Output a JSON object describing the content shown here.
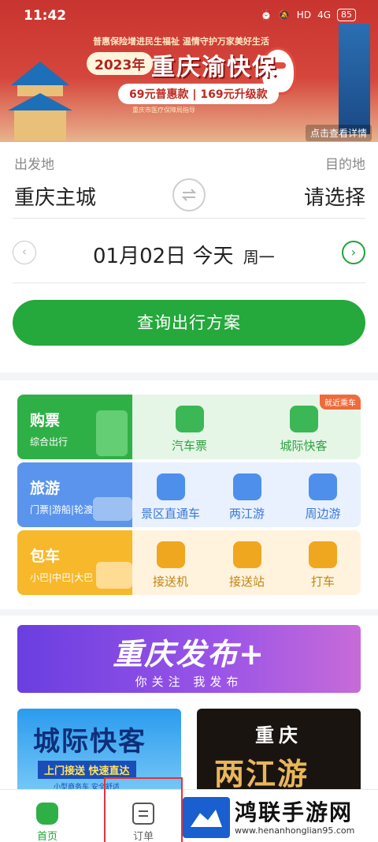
{
  "status_bar": {
    "time": "11:42",
    "network": "4G",
    "hd": "HD",
    "battery": "85"
  },
  "banner": {
    "slogan": "普惠保险增进民生福祉  温情守护万家美好生活",
    "year": "2023年",
    "title": "重庆渝快保",
    "price": "69元普惠款 | 169元升级款",
    "fine_print": "重庆市医疗保障局指导",
    "detail_link": "点击查看详情"
  },
  "search": {
    "from_label": "出发地",
    "to_label": "目的地",
    "from_city": "重庆主城",
    "to_city": "请选择",
    "date": "01月02日",
    "day": "今天",
    "weekday": "周一",
    "query_button": "查询出行方案"
  },
  "services": {
    "rows": [
      {
        "title": "购票",
        "subtitle": "综合出行",
        "items": [
          {
            "label": "汽车票",
            "icon": "car-icon"
          },
          {
            "label": "城际快客",
            "icon": "bus-icon",
            "tag": "就近乘车"
          }
        ]
      },
      {
        "title": "旅游",
        "subtitle": "门票|游船|轮渡",
        "items": [
          {
            "label": "景区直通车",
            "icon": "scenic-bus-icon"
          },
          {
            "label": "两江游",
            "icon": "boat-icon"
          },
          {
            "label": "周边游",
            "icon": "mountain-icon"
          }
        ]
      },
      {
        "title": "包车",
        "subtitle": "小巴|中巴|大巴",
        "items": [
          {
            "label": "接送机",
            "icon": "plane-car-icon"
          },
          {
            "label": "接送站",
            "icon": "station-car-icon"
          },
          {
            "label": "打车",
            "icon": "taxi-icon"
          }
        ]
      }
    ]
  },
  "promo": {
    "banner_title": "重庆发布+",
    "banner_subtitle": "你关注  我发布",
    "card_a_title": "城际快客",
    "card_a_tagline": "上门接送 快速直达",
    "card_a_fine": "小型商务车 安全舒适",
    "card_b_title_1": "重庆",
    "card_b_title_2": "两江游"
  },
  "nav": {
    "home": "首页",
    "orders": "订单"
  },
  "watermark": {
    "title": "鸿联手游网",
    "url": "www.henanhonglian95.com"
  },
  "colors": {
    "accent": "#25a83c",
    "banner_red": "#c8342f",
    "travel_blue": "#5b94ec",
    "charter_yellow": "#f7b82b",
    "highlight_border": "#e0343a"
  }
}
